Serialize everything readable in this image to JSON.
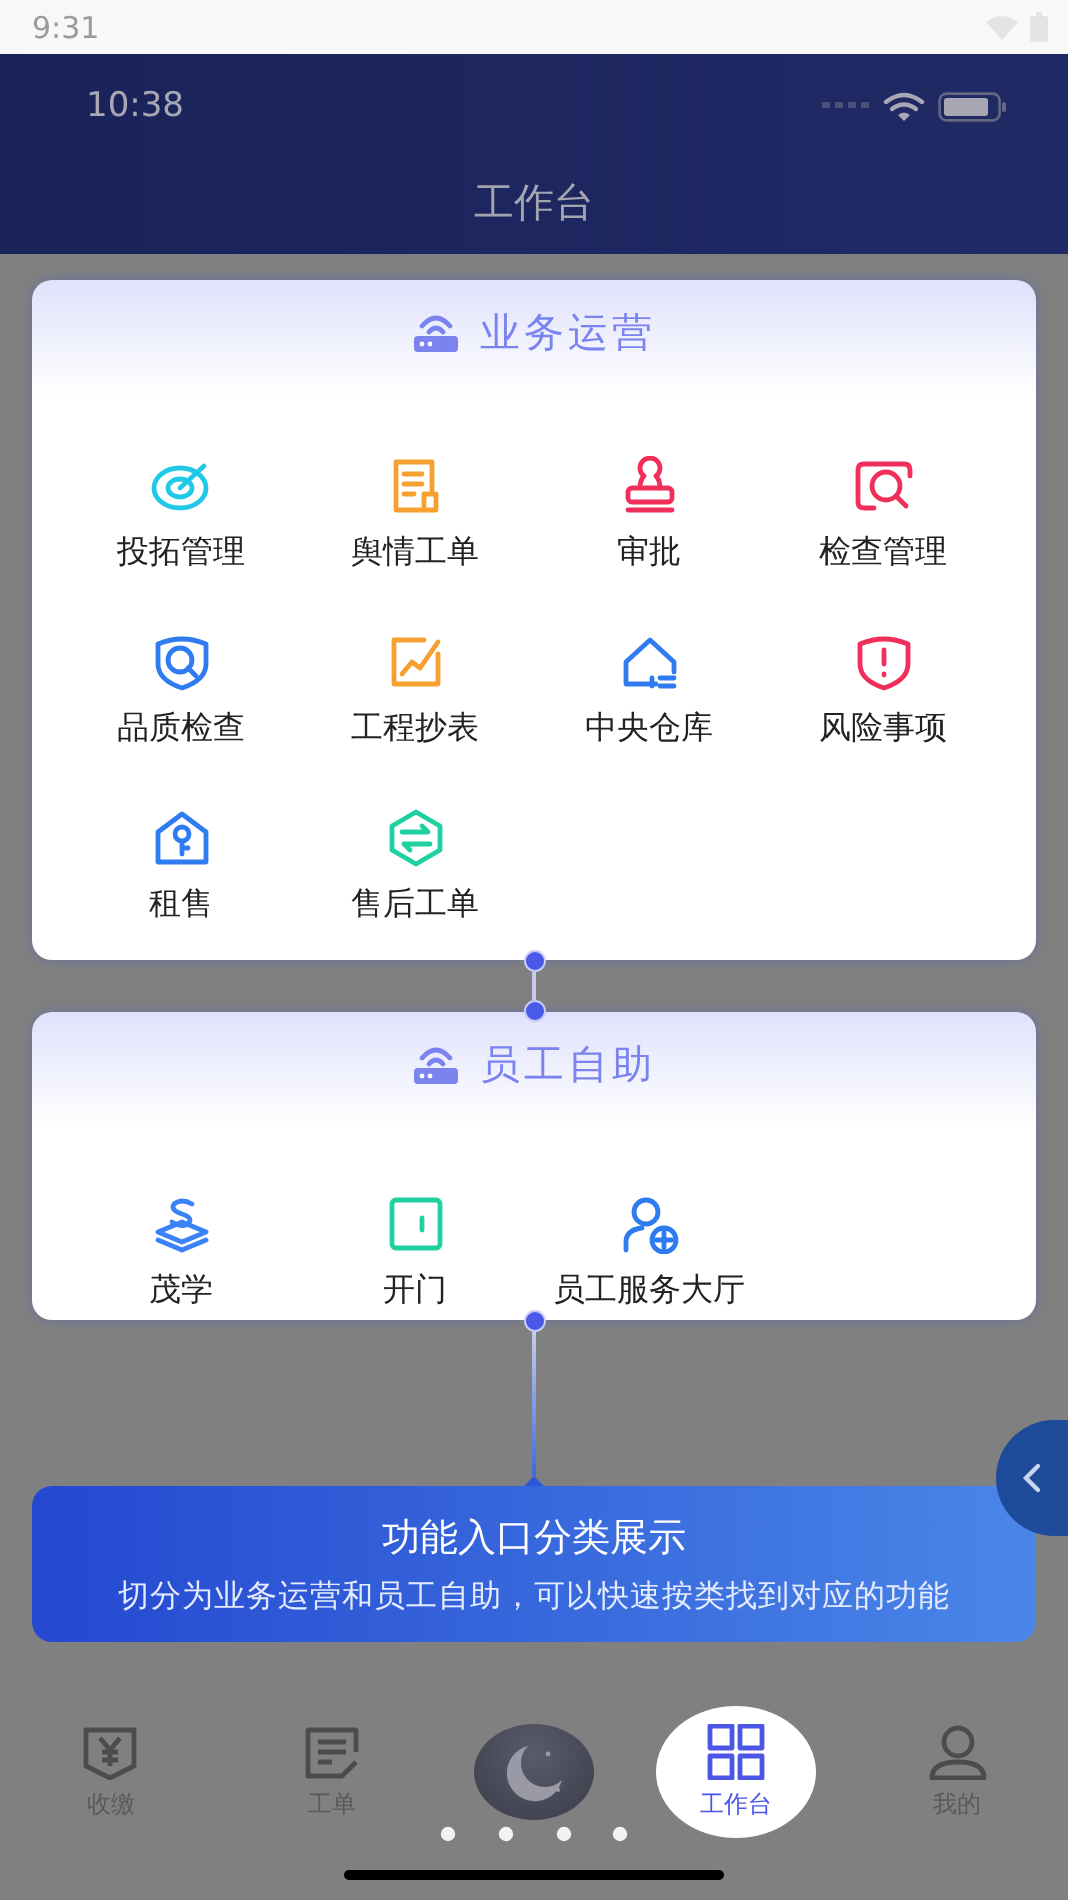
{
  "system_status": {
    "time": "9:31"
  },
  "app_status": {
    "time": "10:38"
  },
  "header": {
    "title": "工作台"
  },
  "sections": [
    {
      "title": "业务运营",
      "items": [
        {
          "label": "投拓管理",
          "kind": "target",
          "color": "#22c8e8"
        },
        {
          "label": "舆情工单",
          "kind": "document",
          "color": "#f5a030"
        },
        {
          "label": "审批",
          "kind": "stamp",
          "color": "#f0305a"
        },
        {
          "label": "检查管理",
          "kind": "inspect",
          "color": "#f0305a"
        },
        {
          "label": "品质检查",
          "kind": "shield",
          "color": "#2f7cf0"
        },
        {
          "label": "工程抄表",
          "kind": "chart",
          "color": "#f5a030"
        },
        {
          "label": "中央仓库",
          "kind": "house",
          "color": "#2f7cf0"
        },
        {
          "label": "风险事项",
          "kind": "alert",
          "color": "#f0305a"
        },
        {
          "label": "租售",
          "kind": "key",
          "color": "#2f7cf0"
        },
        {
          "label": "售后工单",
          "kind": "exchange",
          "color": "#1fd1a0"
        }
      ]
    },
    {
      "title": "员工自助",
      "items": [
        {
          "label": "茂学",
          "kind": "layers",
          "color": "#3a82f6"
        },
        {
          "label": "开门",
          "kind": "door",
          "color": "#1fd1a0"
        },
        {
          "label": "员工服务大厅",
          "kind": "person",
          "color": "#2f7cf0"
        }
      ]
    }
  ],
  "tooltip": {
    "title": "功能入口分类展示",
    "description": "切分为业务运营和员工自助，可以快速按类找到对应的功能"
  },
  "tabs": [
    {
      "kind": "yen",
      "label": "收缴",
      "selected": false
    },
    {
      "kind": "form",
      "label": "工单",
      "selected": false
    },
    {
      "kind": "center"
    },
    {
      "kind": "grid",
      "label": "工作台",
      "selected": true
    },
    {
      "kind": "user",
      "label": "我的",
      "selected": false
    }
  ]
}
